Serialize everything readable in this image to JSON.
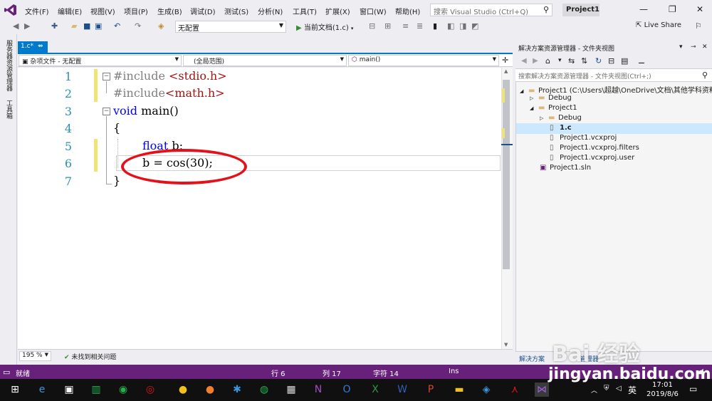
{
  "menu": {
    "items": [
      "文件(F)",
      "编辑(E)",
      "视图(V)",
      "项目(P)",
      "生成(B)",
      "调试(D)",
      "测试(S)",
      "分析(N)",
      "工具(T)",
      "扩展(X)",
      "窗口(W)",
      "帮助(H)"
    ],
    "search_placeholder": "搜索 Visual Studio (Ctrl+Q)",
    "project_title": "Project1"
  },
  "toolbar": {
    "config": "无配置",
    "run_label": "当前文档(1.c)",
    "live_share": "Live Share"
  },
  "left_strip": {
    "server_explorer": "服务器资源管理器",
    "toolbox": "工具箱"
  },
  "doc_tab": {
    "label": "1.c*",
    "pin": "⇴"
  },
  "nav": {
    "project_combo": "杂项文件 - 无配置",
    "scope_combo": "(全局范围)",
    "member_combo": "main()"
  },
  "code": {
    "line_numbers": [
      "1",
      "2",
      "3",
      "4",
      "5",
      "6",
      "7"
    ],
    "line1": {
      "kw": "#include ",
      "str": "<stdio.h>"
    },
    "line2": {
      "kw": "#include",
      "str": "<math.h>"
    },
    "line3": {
      "kw": "void",
      "rest": " main()"
    },
    "line4": "{",
    "line5": {
      "kw": "float",
      "rest": " b;"
    },
    "line6": "b = cos(30);",
    "line7": "}"
  },
  "editor_status": {
    "zoom": "195 %",
    "issues": "未找到相关问题"
  },
  "solution_explorer": {
    "title": "解决方案资源管理器 - 文件夹视图",
    "search_placeholder": "搜索解决方案资源管理器 - 文件夹视图(Ctrl+;)",
    "tree": [
      {
        "label": "Project1 (C:\\Users\\超越\\OneDrive\\文档\\其他学科资料"
      },
      {
        "label": "Debug"
      },
      {
        "label": "Project1"
      },
      {
        "label": "Debug"
      },
      {
        "label": "1.c"
      },
      {
        "label": "Project1.vcxproj"
      },
      {
        "label": "Project1.vcxproj.filters"
      },
      {
        "label": "Project1.vcxproj.user"
      },
      {
        "label": "Project1.sln"
      }
    ],
    "bottom_tab1": "解决方案",
    "bottom_tab2": "管理器"
  },
  "statusbar": {
    "ready": "就绪",
    "row": "行 6",
    "col": "列 17",
    "char": "字符 14",
    "mode": "Ins"
  },
  "taskbar": {
    "ime": "英",
    "time": "17:01",
    "date": "2019/8/6"
  },
  "watermark": {
    "text": "Bai  经验",
    "url": "jingyan.baidu.com"
  },
  "colors": {
    "accent": "#007acc",
    "statusbar": "#68217a",
    "keyword": "#0000ff",
    "preprocessor": "#808080",
    "string": "#a31515",
    "circle": "#e4101a"
  }
}
